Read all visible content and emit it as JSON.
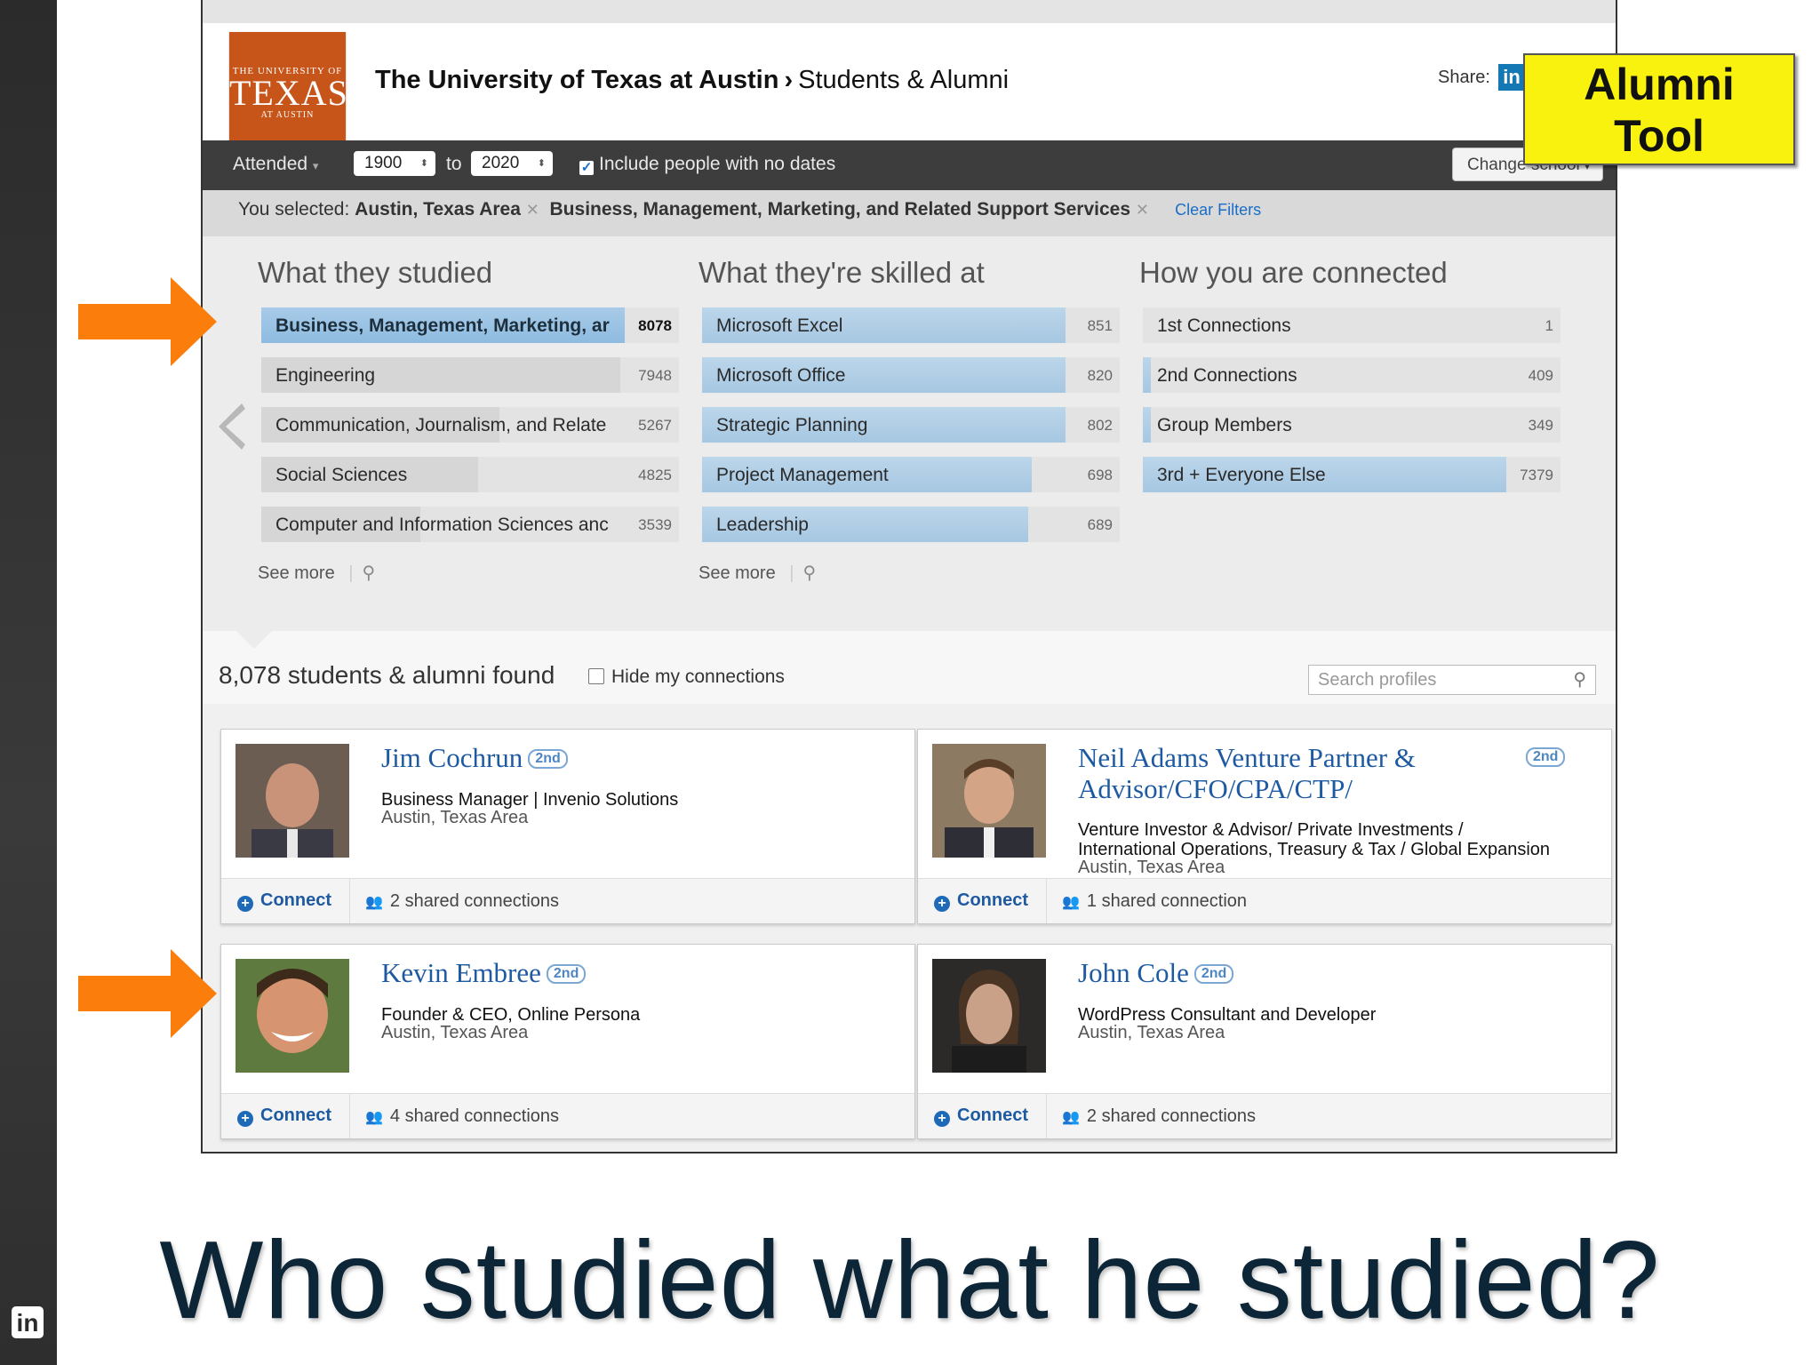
{
  "header": {
    "logo": {
      "line1": "THE UNIVERSITY OF",
      "line2": "TEXAS",
      "line3": "AT AUSTIN"
    },
    "school": "The University of Texas at Austin",
    "section": "Students & Alumni",
    "share_label": "Share:",
    "share_icon": "in"
  },
  "filters": {
    "attended_label": "Attended",
    "from_year": "1900",
    "to_label": "to",
    "to_year": "2020",
    "include_no_dates_label": "Include people with no dates",
    "include_no_dates_checked": true,
    "change_school_label": "Change school"
  },
  "selection": {
    "prefix": "You selected:",
    "chips": [
      "Austin, Texas Area",
      "Business, Management, Marketing, and Related Support Services"
    ],
    "clear_label": "Clear Filters"
  },
  "facets": {
    "studied": {
      "title": "What they studied",
      "items": [
        {
          "label": "Business, Management, Marketing, ar",
          "count": "8078",
          "share": 0.87,
          "active": true
        },
        {
          "label": "Engineering",
          "count": "7948",
          "share": 0.86
        },
        {
          "label": "Communication, Journalism, and Relate",
          "count": "5267",
          "share": 0.57
        },
        {
          "label": "Social Sciences",
          "count": "4825",
          "share": 0.52
        },
        {
          "label": "Computer and Information Sciences anc",
          "count": "3539",
          "share": 0.38
        }
      ],
      "see_more": "See more"
    },
    "skills": {
      "title": "What they're skilled at",
      "items": [
        {
          "label": "Microsoft Excel",
          "count": "851",
          "share": 0.87
        },
        {
          "label": "Microsoft Office",
          "count": "820",
          "share": 0.87
        },
        {
          "label": "Strategic Planning",
          "count": "802",
          "share": 0.87
        },
        {
          "label": "Project Management",
          "count": "698",
          "share": 0.79
        },
        {
          "label": "Leadership",
          "count": "689",
          "share": 0.78
        }
      ],
      "see_more": "See more"
    },
    "connected": {
      "title": "How you are connected",
      "items": [
        {
          "label": "1st Connections",
          "count": "1",
          "share": 0.0
        },
        {
          "label": "2nd Connections",
          "count": "409",
          "share": 0.02
        },
        {
          "label": "Group Members",
          "count": "349",
          "share": 0.02
        },
        {
          "label": "3rd + Everyone Else",
          "count": "7379",
          "share": 0.87
        }
      ]
    }
  },
  "results": {
    "count_text": "8,078 students & alumni found",
    "hide_label": "Hide my connections",
    "search_placeholder": "Search profiles",
    "connect_label": "Connect",
    "profiles": [
      {
        "name": "Jim Cochrun",
        "degree": "2nd",
        "headline": [
          "Business Manager | Invenio Solutions"
        ],
        "location": "Austin, Texas Area",
        "shared": "2 shared connections"
      },
      {
        "name": "Neil Adams Venture Partner &",
        "name2": "Advisor/CFO/CPA/CTP/",
        "degree": "2nd",
        "headline": [
          "Venture Investor & Advisor/ Private Investments /",
          "International Operations, Treasury & Tax / Global Expansion"
        ],
        "location": "Austin, Texas Area",
        "shared": "1 shared connection"
      },
      {
        "name": "Kevin Embree",
        "degree": "2nd",
        "headline": [
          "Founder & CEO, Online Persona"
        ],
        "location": "Austin, Texas Area",
        "shared": "4 shared connections"
      },
      {
        "name": "John Cole",
        "degree": "2nd",
        "headline": [
          "WordPress Consultant and Developer"
        ],
        "location": "Austin, Texas Area",
        "shared": "2 shared connections"
      }
    ]
  },
  "callout": {
    "line1": "Alumni",
    "line2": "Tool"
  },
  "caption": "Who studied what he studied?",
  "colors": {
    "accent_orange": "#fb7d0b",
    "callout_yellow": "#f8f20e",
    "ut_orange": "#c75418",
    "link_blue": "#1e5aa1"
  }
}
